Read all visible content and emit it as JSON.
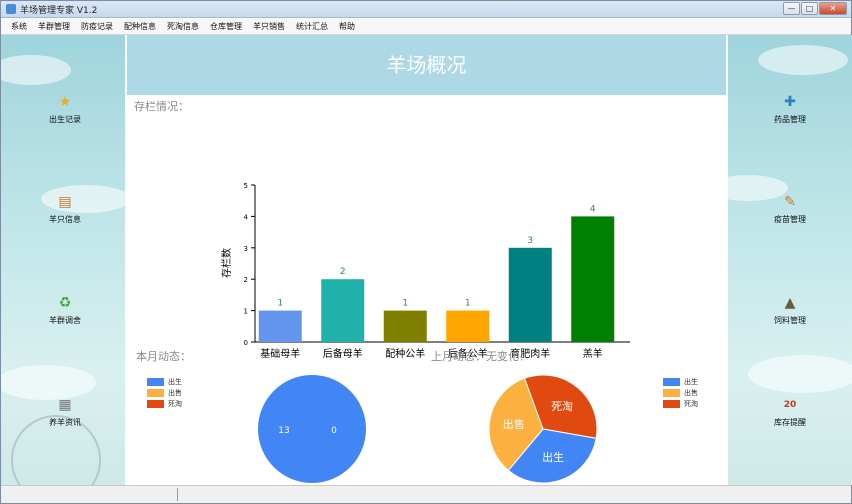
{
  "window": {
    "title": "羊场管理专家 V1.2",
    "controls": [
      "—",
      "□",
      "✕"
    ]
  },
  "menu": [
    "系统",
    "羊群管理",
    "防疫记录",
    "配种信息",
    "死淘信息",
    "仓库管理",
    "羊只销售",
    "统计汇总",
    "帮助"
  ],
  "left_nav": [
    {
      "label": "出生记录",
      "icon": "star-lamb-icon",
      "glyph": "★",
      "color": "#e9b21a"
    },
    {
      "label": "羊只信息",
      "icon": "document-icon",
      "glyph": "▤",
      "color": "#c8752c"
    },
    {
      "label": "羊群调舍",
      "icon": "recycle-icon",
      "glyph": "♻",
      "color": "#4aa63a"
    },
    {
      "label": "养羊资讯",
      "icon": "news-icon",
      "glyph": "▦",
      "color": "#777777"
    }
  ],
  "right_nav": [
    {
      "label": "药品管理",
      "icon": "medicine-icon",
      "glyph": "✚",
      "color": "#2f7fc0"
    },
    {
      "label": "疫苗管理",
      "icon": "syringe-icon",
      "glyph": "✎",
      "color": "#c87a2a"
    },
    {
      "label": "饲料管理",
      "icon": "feed-icon",
      "glyph": "▲",
      "color": "#6a5a3a"
    },
    {
      "label": "库存提醒",
      "icon": "calendar-icon",
      "glyph": "20",
      "color": "#c0392b"
    }
  ],
  "page_title": "羊场概况",
  "stock_label": "存栏情况：",
  "chart_data": [
    {
      "type": "bar",
      "ylabel": "存栏数",
      "ylim": [
        0,
        5
      ],
      "yticks": [
        "0",
        "1",
        "2",
        "3",
        "4",
        "5"
      ],
      "categories": [
        "基础母羊",
        "后备母羊",
        "配种公羊",
        "后备公羊",
        "育肥肉羊",
        "羔羊"
      ],
      "values": [
        1,
        2,
        1,
        1,
        3,
        4
      ],
      "data_labels": [
        "1",
        "2",
        "1",
        "1",
        "3",
        "4"
      ],
      "colors": [
        "#6495ed",
        "#20b2aa",
        "#808000",
        "#ffa500",
        "#008080",
        "#008000"
      ]
    },
    {
      "type": "pie",
      "section": "本月动态：",
      "legend": [
        "出生",
        "出售",
        "死淘"
      ],
      "legend_colors": [
        "#4285f4",
        "#fbb040",
        "#e04a10"
      ],
      "values": [
        13,
        0,
        0
      ],
      "slice_labels": [
        "13",
        "0"
      ]
    },
    {
      "type": "pie",
      "section": "上月动态：无变化！",
      "legend": [
        "出生",
        "出售",
        "死淘"
      ],
      "legend_colors": [
        "#4285f4",
        "#fbb040",
        "#e04a10"
      ],
      "values": [
        1,
        1,
        1
      ],
      "slice_labels": [
        "出生",
        "出售",
        "死淘"
      ]
    }
  ]
}
